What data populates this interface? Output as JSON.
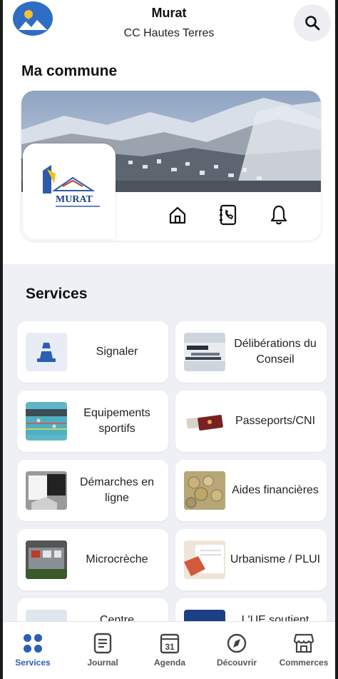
{
  "header": {
    "town_name": "Murat",
    "town_subtitle": "CC Hautes Terres",
    "search_icon": "search-icon"
  },
  "commune": {
    "section_title": "Ma commune",
    "logo_text": "MURAT",
    "actions": [
      {
        "icon": "home-icon"
      },
      {
        "icon": "phone-book-icon"
      },
      {
        "icon": "bell-icon"
      }
    ]
  },
  "services": {
    "section_title": "Services",
    "tiles": [
      {
        "label": "Signaler"
      },
      {
        "label": "Délibérations du Conseil"
      },
      {
        "label": "Equipements sportifs"
      },
      {
        "label": "Passeports/CNI"
      },
      {
        "label": "Démarches en ligne"
      },
      {
        "label": "Aides financières"
      },
      {
        "label": "Microcrèche"
      },
      {
        "label": "Urbanisme / PLUI"
      },
      {
        "label": "Centre"
      },
      {
        "label": "L'UE soutient"
      }
    ]
  },
  "nav": {
    "active": "Services",
    "accent": "#2c5fb3",
    "items": [
      {
        "label": "Services",
        "icon": "grid-icon"
      },
      {
        "label": "Journal",
        "icon": "journal-icon"
      },
      {
        "label": "Agenda",
        "icon": "calendar-icon",
        "badge": "31"
      },
      {
        "label": "Découvrir",
        "icon": "compass-icon"
      },
      {
        "label": "Commerces",
        "icon": "shop-icon"
      }
    ]
  }
}
